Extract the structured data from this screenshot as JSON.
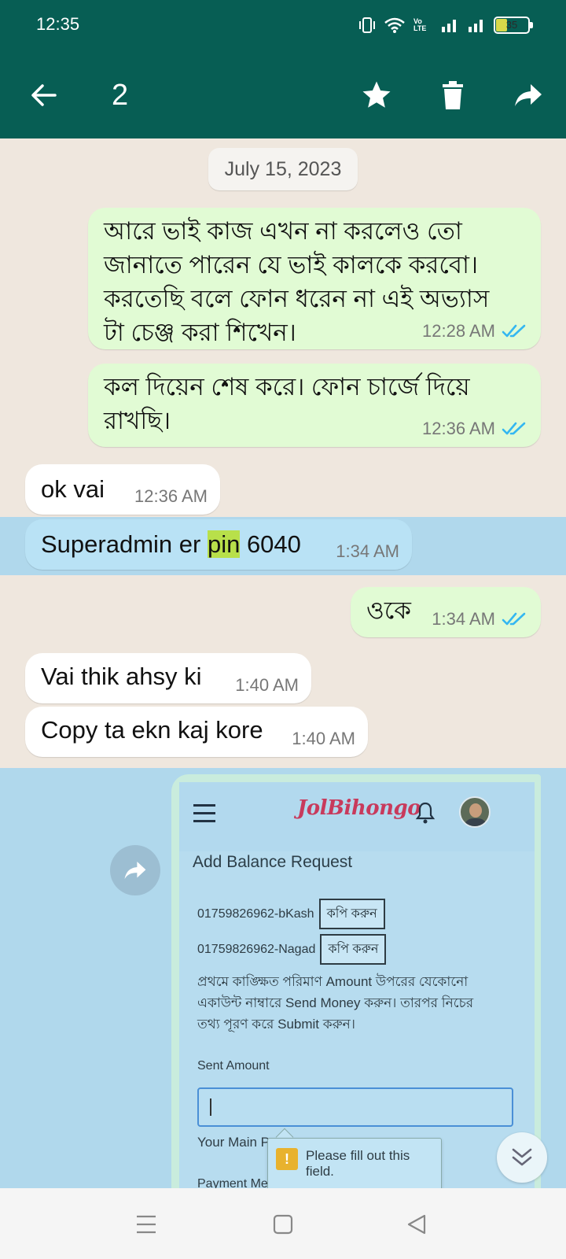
{
  "status": {
    "time": "12:35",
    "volte": "Vo LTE",
    "battery": "35",
    "battery_fraction": 0.35
  },
  "toolbar": {
    "selected_count": "2",
    "icons": [
      "back-arrow-icon",
      "star-icon",
      "delete-icon",
      "forward-icon"
    ]
  },
  "chat": {
    "date_chip": "July 15, 2023",
    "messages": [
      {
        "dir": "out",
        "lines": [
          "আরে ভাই কাজ এখন না করলেও তো",
          "জানাতে পারেন যে ভাই কালকে করবো।",
          "করতেছি বলে ফোন ধরেন না এই অভ্যাস",
          "টা চেঞ্জ করা শিখেন।"
        ],
        "time": "12:28 AM"
      },
      {
        "dir": "out",
        "lines": [
          "কল দিয়েন শেষ করে। ফোন চার্জে দিয়ে",
          "রাখছি।"
        ],
        "time": "12:36 AM"
      },
      {
        "dir": "in",
        "text": "ok vai",
        "time": "12:36 AM"
      },
      {
        "dir": "in",
        "selected": true,
        "text_before": "Superadmin er ",
        "highlight": "pin",
        "text_after": " 6040",
        "time": "1:34 AM"
      },
      {
        "dir": "out",
        "text": "ওকে",
        "time": "1:34 AM"
      },
      {
        "dir": "in",
        "text": "Vai thik ahsy ki",
        "time": "1:40 AM"
      },
      {
        "dir": "in",
        "text": "Copy ta ekn kaj kore",
        "time": "1:40 AM"
      }
    ]
  },
  "screenshot": {
    "logo": "JolBihongo",
    "title": "Add Balance Request",
    "accounts": [
      {
        "number": "01759826962-bKash",
        "copy": "কপি করুন"
      },
      {
        "number": "01759826962-Nagad",
        "copy": "কপি করুন"
      }
    ],
    "instructions": [
      "প্রথমে কাঙ্ক্ষিত পরিমাণ Amount উপরের যেকোনো",
      "একাউন্ট নাম্বারে Send Money করুন। তারপর নিচের",
      "তথ্য পূরণ করে Submit করুন।"
    ],
    "sent_amount_label": "Sent Amount",
    "main_label": "Your Main P",
    "payment_label": "Payment Me",
    "tooltip": "Please fill out this field."
  },
  "colors": {
    "header": "#075e54",
    "outgoing": "#e1fbd4",
    "incoming": "#ffffff",
    "selection": "#b0d8ec",
    "read_ticks": "#34b7f1",
    "highlight": "#b8e04a"
  }
}
